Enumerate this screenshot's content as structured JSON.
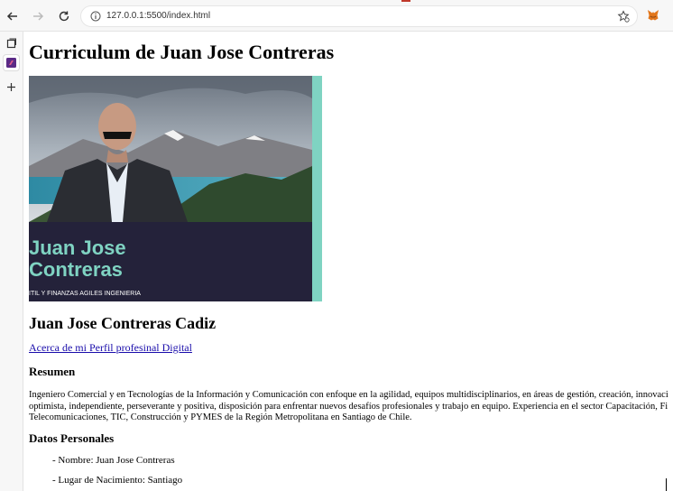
{
  "browser": {
    "url": "127.0.0.1:5500/index.html",
    "colors": {
      "accent": "#c0392b",
      "link": "#1a0dab",
      "photo_stripe": "#7fd3c2",
      "photo_banner": "#24223a"
    }
  },
  "sidebar": {
    "items": [
      {
        "icon": "tab-actions-icon"
      },
      {
        "icon": "app-icon"
      },
      {
        "icon": "plus-icon"
      }
    ]
  },
  "page": {
    "title": "Curriculum de Juan Jose Contreras",
    "photo": {
      "name_line1": "Juan Jose",
      "name_line2": "Contreras",
      "caption": "ITIL Y FINANZAS AGILES INGENIERIA"
    },
    "name_heading": "Juan Jose Contreras Cadiz",
    "profile_link": "Acerca de mi Perfil profesinal Digital",
    "resumen_heading": "Resumen",
    "resumen_lines": [
      "Ingeniero Comercial y en Tecnologías de la Información y Comunicación con enfoque en la agilidad, equipos multidisciplinarios, en áreas de gestión, creación, innovaci",
      "optimista, independiente, perseverante y positiva, disposición para enfrentar nuevos desafíos profesionales y trabajo en equipo. Experiencia en el sector Capacitación, Fi",
      "Telecomunicaciones, TIC, Construcción y PYMES de la Región Metropolitana en Santiago de Chile."
    ],
    "datos_heading": "Datos Personales",
    "datos": [
      "- Nombre: Juan Jose Contreras",
      "- Lugar de Nacimiento: Santiago"
    ]
  }
}
